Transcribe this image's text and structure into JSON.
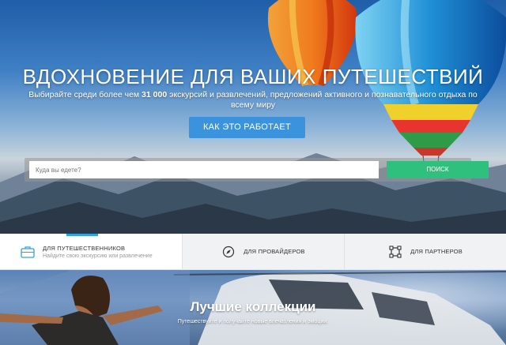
{
  "hero": {
    "title": "ВДОХНОВЕНИЕ ДЛЯ ВАШИХ ПУТЕШЕСТВИЙ",
    "subtitle_before": "Выбирайте среди более чем ",
    "subtitle_bold": "31 000",
    "subtitle_after": " экскурсий и развлечений, предложений активного и познавательного отдыха по всему миру",
    "how_button": "КАК ЭТО РАБОТАЕТ",
    "search_placeholder": "Куда вы едете?",
    "search_button": "ПОИСК"
  },
  "tabs": [
    {
      "label": "ДЛЯ ПУТЕШЕСТВЕННИКОВ",
      "sub": "Найдите свою экскурсию или развлечение",
      "icon": "briefcase-icon",
      "active": true
    },
    {
      "label": "ДЛЯ ПРОВАЙДЕРОВ",
      "icon": "compass-icon",
      "active": false
    },
    {
      "label": "ДЛЯ ПАРТНЕРОВ",
      "icon": "frame-icon",
      "active": false
    }
  ],
  "collections": {
    "title": "Лучшие коллекции",
    "subtitle": "Путешествуйте и получайте новые впечатления и эмоции."
  },
  "colors": {
    "primary_button": "#3b93de",
    "search_button": "#2fc07e",
    "active_tab_accent": "#2fa3de"
  }
}
